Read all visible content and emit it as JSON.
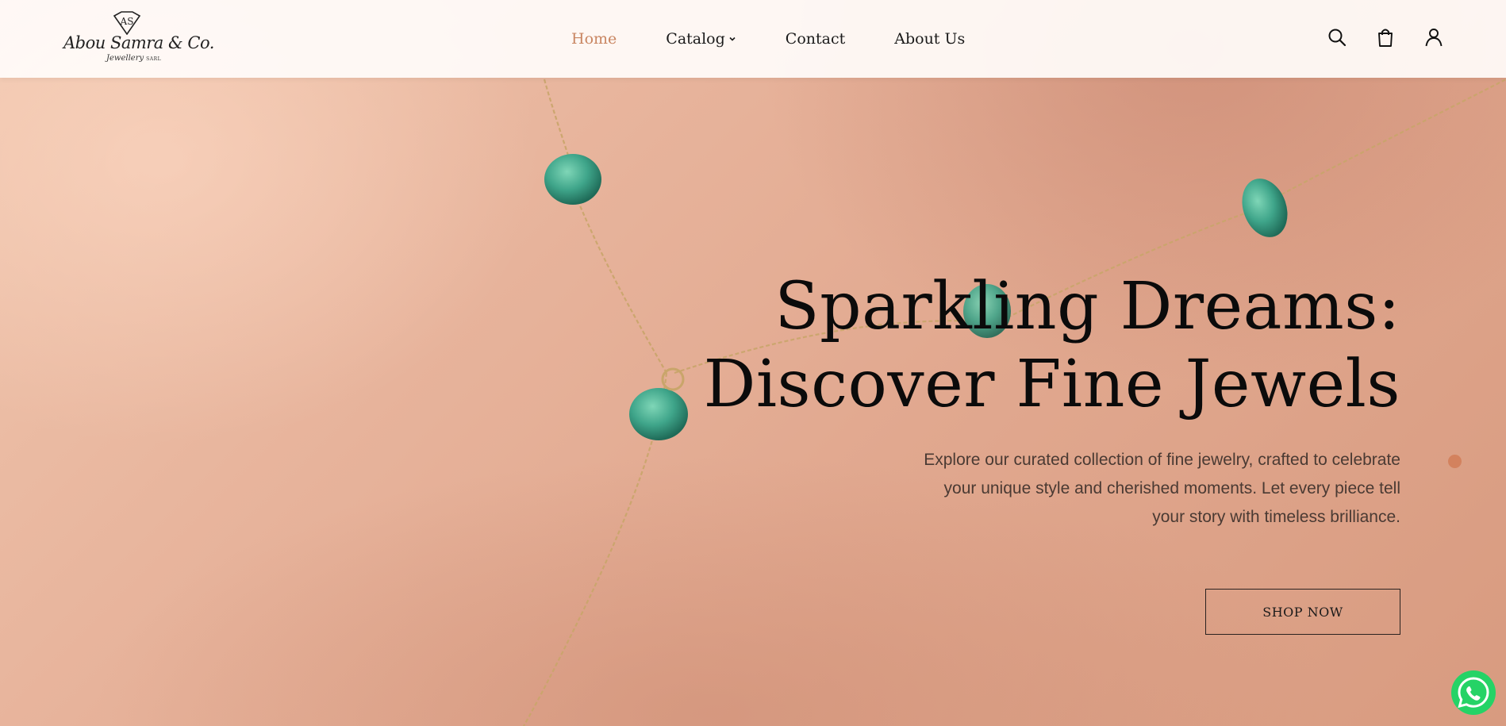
{
  "brand": {
    "logo_mark": "AS",
    "name": "Abou Samra & Co.",
    "sub": "Jewellery",
    "suffix": "SARL"
  },
  "nav": {
    "items": [
      {
        "label": "Home",
        "active": true
      },
      {
        "label": "Catalog",
        "has_dropdown": true
      },
      {
        "label": "Contact"
      },
      {
        "label": "About Us"
      }
    ]
  },
  "header_icons": [
    "search-icon",
    "shopping-bag-icon",
    "user-icon"
  ],
  "hero": {
    "title_line1": "Sparkling Dreams:",
    "title_line2": "Discover Fine Jewels",
    "description": "Explore our curated collection of fine jewelry, crafted to celebrate your unique style and cherished moments. Let every piece tell your story with timeless brilliance.",
    "cta_label": "SHOP NOW"
  },
  "carousel": {
    "slide_count": 1,
    "active_slide": 1
  },
  "floating": {
    "icon": "whatsapp-icon"
  },
  "colors": {
    "accent": "#c98662",
    "dot": "#d3825e",
    "whatsapp": "#25d366",
    "gem": "#3fa58a"
  }
}
